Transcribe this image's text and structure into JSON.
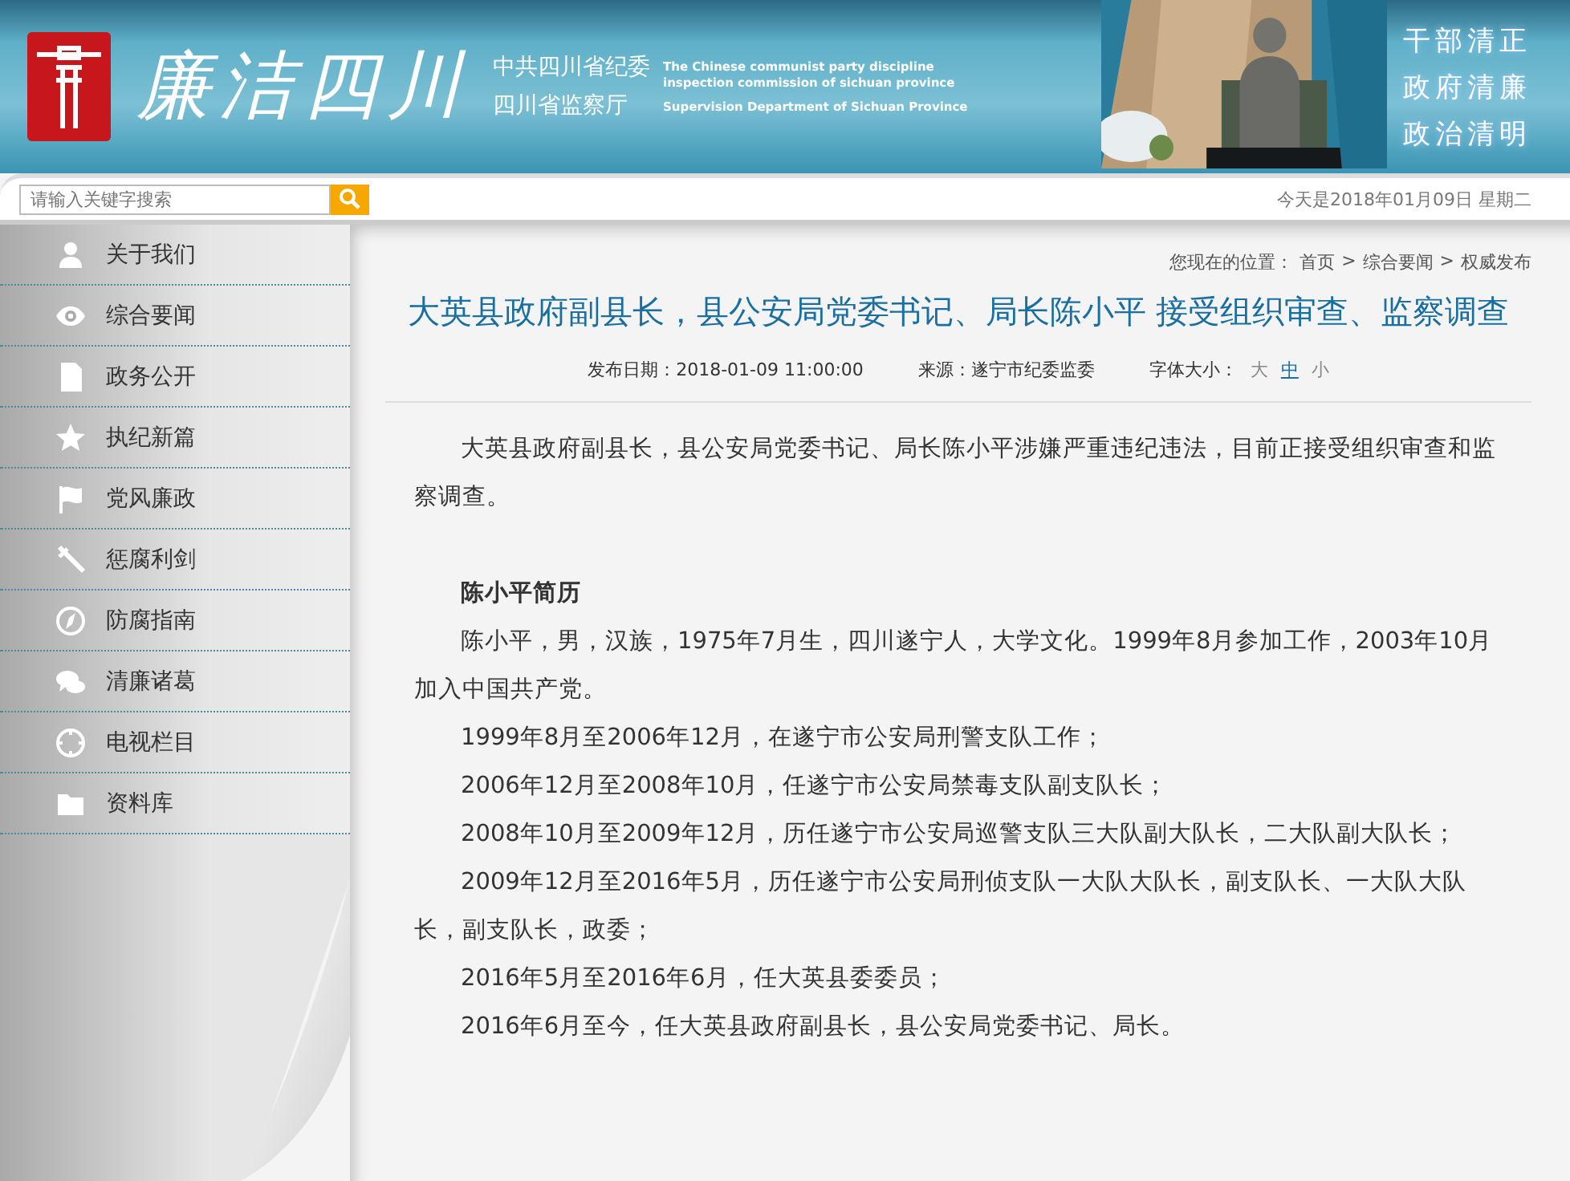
{
  "header": {
    "logo_text": "廉洁四川",
    "org_cn": [
      "中共四川省纪委",
      "四川省监察厅"
    ],
    "org_en": [
      "The Chinese communist party discipline",
      "inspection  commission of sichuan province",
      "Supervision Department of Sichuan Province"
    ],
    "slogans": [
      "干部清正",
      "政府清廉",
      "政治清明"
    ]
  },
  "search": {
    "placeholder": "请输入关键字搜索"
  },
  "date": "今天是2018年01月09日 星期二",
  "sidebar": {
    "items": [
      {
        "label": "关于我们"
      },
      {
        "label": "综合要闻"
      },
      {
        "label": "政务公开"
      },
      {
        "label": "执纪新篇"
      },
      {
        "label": "党风廉政"
      },
      {
        "label": "惩腐利剑"
      },
      {
        "label": "防腐指南"
      },
      {
        "label": "清廉诸葛"
      },
      {
        "label": "电视栏目"
      },
      {
        "label": "资料库"
      }
    ]
  },
  "breadcrumb": {
    "prefix": "您现在的位置：",
    "separator": ">",
    "items": [
      "首页",
      "综合要闻",
      "权威发布"
    ]
  },
  "article": {
    "title": "大英县政府副县长，县公安局党委书记、局长陈小平 接受组织审查、监察调查",
    "meta": [
      "发布日期：2018-01-09 11:00:00",
      "来源：遂宁市纪委监委"
    ],
    "font_size": {
      "label": "字体大小：",
      "options": [
        {
          "label": "大",
          "selected": false
        },
        {
          "label": "中",
          "selected": true
        },
        {
          "label": "小",
          "selected": false
        }
      ]
    },
    "paragraphs": [
      {
        "kind": "text",
        "text": "大英县政府副县长，县公安局党委书记、局长陈小平涉嫌严重违纪违法，目前正接受组织审查和监察调查。"
      },
      {
        "kind": "heading",
        "text": "陈小平简历"
      },
      {
        "kind": "text",
        "text": "陈小平，男，汉族，1975年7月生，四川遂宁人，大学文化。1999年8月参加工作，2003年10月加入中国共产党。"
      },
      {
        "kind": "text",
        "text": "1999年8月至2006年12月，在遂宁市公安局刑警支队工作；"
      },
      {
        "kind": "text",
        "text": "2006年12月至2008年10月，任遂宁市公安局禁毒支队副支队长；"
      },
      {
        "kind": "text",
        "text": "2008年10月至2009年12月，历任遂宁市公安局巡警支队三大队副大队长，二大队副大队长；"
      },
      {
        "kind": "text",
        "text": "2009年12月至2016年5月，历任遂宁市公安局刑侦支队一大队大队长，副支队长、一大队大队长，副支队长，政委；"
      },
      {
        "kind": "text",
        "text": "2016年5月至2016年6月，任大英县委委员；"
      },
      {
        "kind": "text",
        "text": "2016年6月至今，任大英县政府副县长，县公安局党委书记、局长。"
      }
    ]
  }
}
